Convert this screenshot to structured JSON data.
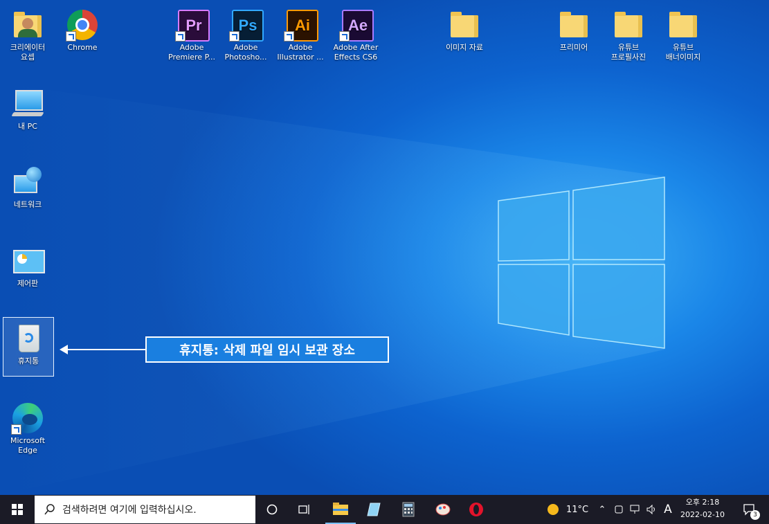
{
  "desktop_icons": {
    "creator": "크리에이터\n요셉",
    "chrome": "Chrome",
    "premiere": "Adobe\nPremiere P...",
    "photoshop": "Adobe\nPhotosho...",
    "illustrator": "Adobe\nIllustrator ...",
    "aftereffects": "Adobe After\nEffects CS6",
    "image_folder": "이미지 자료",
    "premiere_folder": "프리미어",
    "youtube_profile": "유튜브\n프로필사진",
    "youtube_banner": "유튜브\n배너이미지",
    "my_pc": "내 PC",
    "network": "네트워크",
    "control_panel": "제어판",
    "recycle_bin": "휴지통",
    "edge": "Microsoft\nEdge"
  },
  "adobe_abbr": {
    "pr": "Pr",
    "ps": "Ps",
    "ai": "Ai",
    "ae": "Ae"
  },
  "callout": {
    "text": "휴지통: 삭제 파일 임시 보관 장소"
  },
  "taskbar": {
    "search_placeholder": "검색하려면 여기에 입력하십시오.",
    "weather": "11°C",
    "ime": "A",
    "time_period": "오후 2:18",
    "date": "2022-02-10",
    "notifications": "3"
  },
  "colors": {
    "accent": "#0a63cf",
    "taskbar": "#1b1b26"
  }
}
